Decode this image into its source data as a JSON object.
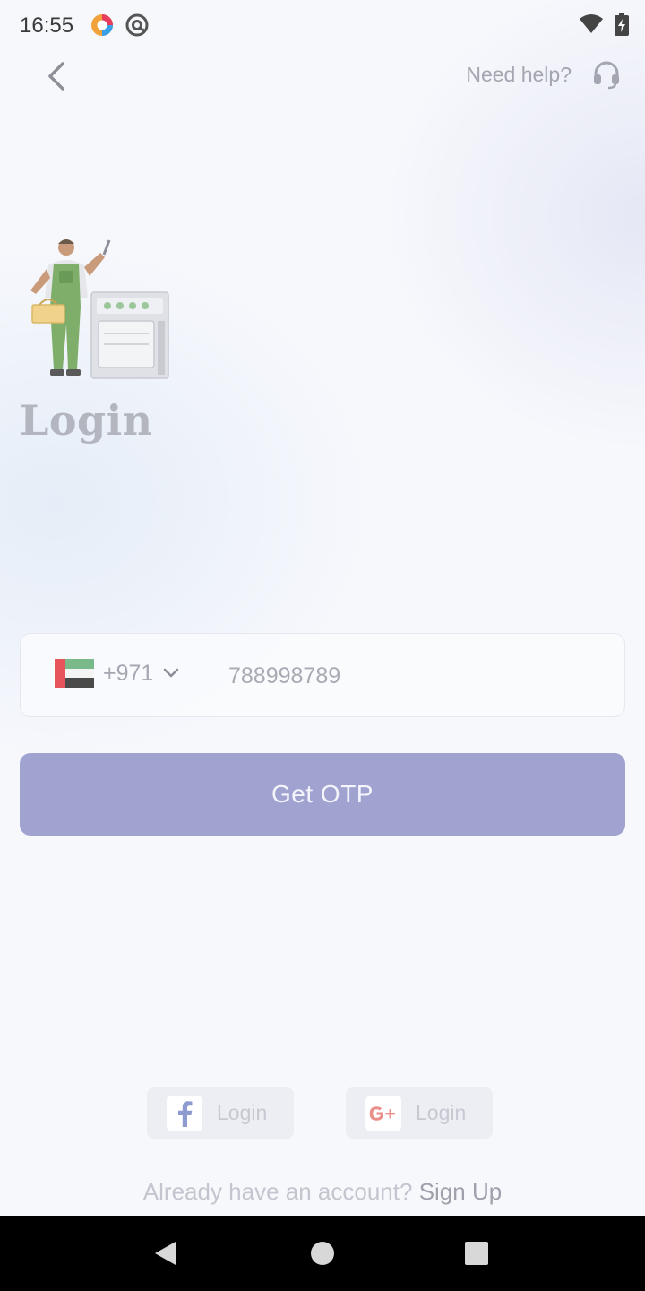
{
  "status_bar": {
    "time": "16:55",
    "app_icons": [
      "colorful-circle-app-icon",
      "at-sign-app-icon"
    ],
    "system_icons": [
      "wifi-icon",
      "battery-charging-icon"
    ]
  },
  "header": {
    "back_icon": "chevron-left-icon",
    "help_label": "Need help?",
    "help_icon": "headset-icon"
  },
  "hero": {
    "illustration": "handyman-with-stove-illustration",
    "title": "Login"
  },
  "phone": {
    "country_flag": "uae-flag-icon",
    "country_code": "+971",
    "number": "788998789"
  },
  "actions": {
    "otp_label": "Get OTP"
  },
  "social": {
    "facebook_label": "Login",
    "google_label": "Login"
  },
  "footer": {
    "account_prompt": "Already have an account?",
    "signup_label": "Sign Up"
  },
  "colors": {
    "primary": "#a0a2d0",
    "background": "#f7f8fc",
    "muted_text": "#a3a6b0"
  }
}
